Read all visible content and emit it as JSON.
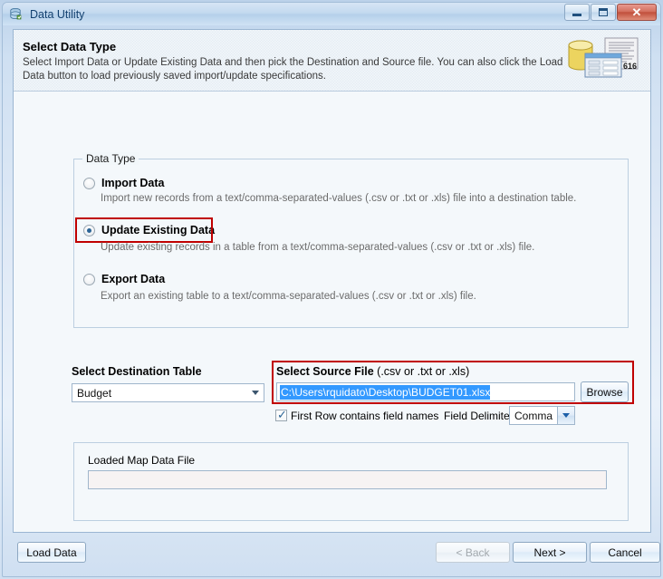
{
  "window": {
    "title": "Data Utility",
    "icon": "database-utility-icon",
    "controls": {
      "minimize": "minimize-icon",
      "maximize": "maximize-icon",
      "close": "✕"
    }
  },
  "header": {
    "title": "Select Data Type",
    "description": "Select Import Data or Update Existing Data and then pick the Destination and Source file.  You can also click the Load Data button to load previously saved import/update specifications.",
    "icon": "database-documents-icon",
    "icon_badge": "616"
  },
  "data_type_group": {
    "legend": "Data Type",
    "options": [
      {
        "label": "Import Data",
        "description": "Import new records from a text/comma-separated-values (.csv or .txt or .xls) file into a destination table.",
        "selected": false,
        "highlighted": false
      },
      {
        "label": "Update Existing Data",
        "description": "Update existing records in a table from a text/comma-separated-values (.csv or .txt or .xls) file.",
        "selected": true,
        "highlighted": true
      },
      {
        "label": "Export Data",
        "description": "Export an existing table to a text/comma-separated-values (.csv or .txt or .xls) file.",
        "selected": false,
        "highlighted": false
      }
    ]
  },
  "destination": {
    "label": "Select Destination Table",
    "selected_table": "Budget",
    "dropdown_icon": "chevron-down-icon"
  },
  "source": {
    "label_bold": "Select Source File",
    "label_suffix": " (.csv or .txt or .xls)",
    "path_value": "C:\\Users\\rquidato\\Desktop\\BUDGET01.xlsx",
    "path_selected": true,
    "browse_label": "Browse",
    "first_row_label": "First Row contains field names",
    "first_row_checked": true,
    "delimiter_label": "Field Delimiter",
    "delimiter_value": "Comma",
    "highlighted": true
  },
  "map_file_group": {
    "label": "Loaded Map Data File",
    "value": ""
  },
  "footer": {
    "load_data_label": "Load Data",
    "back_label": "< Back",
    "back_enabled": false,
    "next_label": "Next >",
    "cancel_label": "Cancel"
  },
  "colors": {
    "highlight_red": "#c00000",
    "selection_blue": "#3399ff",
    "title_blue": "#12406f"
  }
}
